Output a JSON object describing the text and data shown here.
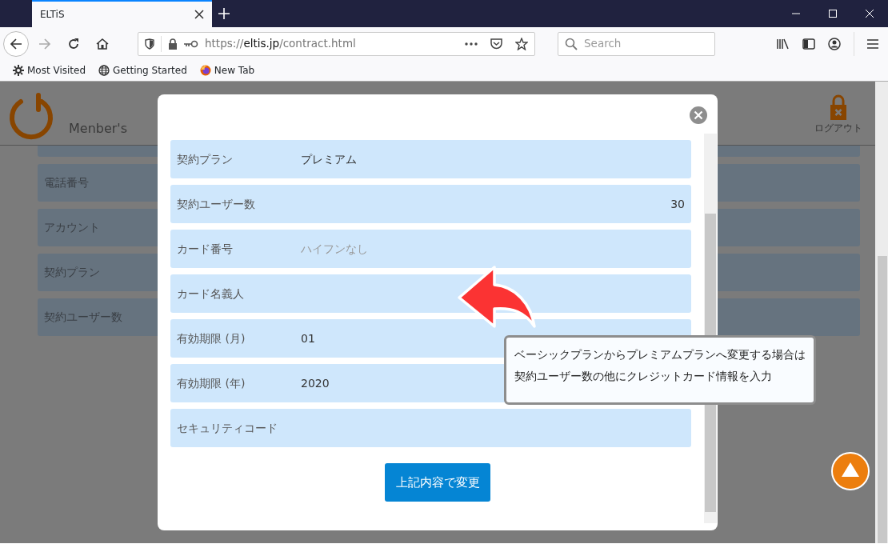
{
  "browser": {
    "tabs": [
      {
        "title": "ELTiS",
        "selected": true
      }
    ],
    "url": {
      "scheme": "https://",
      "host": "eltis.jp",
      "path": "/contract.html"
    },
    "search": {
      "placeholder": "Search"
    },
    "bookmarks": [
      {
        "label": "Most Visited",
        "kind": "gear"
      },
      {
        "label": "Getting Started",
        "kind": "globe"
      },
      {
        "label": "New Tab",
        "kind": "firefox"
      }
    ]
  },
  "page": {
    "brand": "Menber's",
    "logout": "ログアウト",
    "rows": [
      "電話番号",
      "アカウント",
      "契約プラン",
      "契約ユーザー数"
    ]
  },
  "modal": {
    "fields": [
      {
        "label": "契約プラン",
        "value": "プレミアム",
        "kind": "text"
      },
      {
        "label": "契約ユーザー数",
        "value": "30",
        "kind": "number"
      },
      {
        "label": "カード番号",
        "placeholder": "ハイフンなし",
        "kind": "text"
      },
      {
        "label": "カード名義人",
        "kind": "text"
      },
      {
        "label": "有効期限 (月)",
        "value": "01",
        "kind": "text"
      },
      {
        "label": "有効期限 (年)",
        "value": "2020",
        "kind": "text"
      },
      {
        "label": "セキュリティコード",
        "kind": "text"
      }
    ],
    "submit": "上記内容で変更"
  },
  "callout": {
    "lines": [
      "ベーシックプランからプレミアムプランへ変更する場合は",
      "契約ユーザー数の他にクレジットカード情報を入力"
    ]
  }
}
